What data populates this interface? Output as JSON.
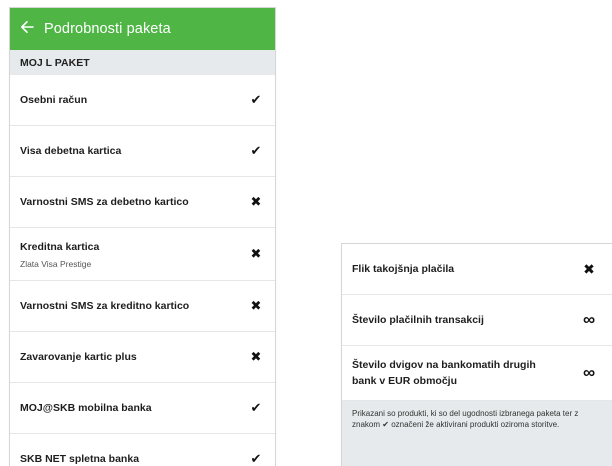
{
  "left_screen": {
    "appbar": {
      "back_icon": "arrow-left-icon",
      "title": "Podrobnosti paketa",
      "color": "#4fb646"
    },
    "section_title": "MOJ L PAKET",
    "items": [
      {
        "label": "Osebni račun",
        "status_icon": "check-icon",
        "status": "✔"
      },
      {
        "label": "Visa debetna kartica",
        "status_icon": "check-icon",
        "status": "✔"
      },
      {
        "label": "Varnostni SMS za debetno kartico",
        "status_icon": "cross-icon",
        "status": "✖"
      },
      {
        "label": "Kreditna kartica",
        "sublabel": "Zlata Visa Prestige",
        "status_icon": "cross-icon",
        "status": "✖"
      },
      {
        "label": "Varnostni SMS za kreditno kartico",
        "status_icon": "cross-icon",
        "status": "✖"
      },
      {
        "label": "Zavarovanje kartic plus",
        "status_icon": "cross-icon",
        "status": "✖"
      },
      {
        "label": "MOJ@SKB mobilna banka",
        "status_icon": "check-icon",
        "status": "✔"
      },
      {
        "label": "SKB NET spletna banka",
        "status_icon": "check-icon",
        "status": "✔"
      }
    ]
  },
  "right_screen": {
    "items": [
      {
        "label": "Flik takojšnja plačila",
        "status_icon": "cross-icon",
        "status": "✖"
      },
      {
        "label": "Število plačilnih transakcij",
        "status_icon": "infinity-icon",
        "status": "∞"
      },
      {
        "label_line1": "Število dvigov na bankomatih drugih",
        "label_line2": "bank v EUR območju",
        "status_icon": "infinity-icon",
        "status": "∞"
      }
    ],
    "note": {
      "before": "Prikazani so produkti, ki so del ugodnosti izbranega paketa ter z znakom",
      "check": "✔",
      "after": "označeni že aktivirani produkti oziroma storitve."
    }
  }
}
